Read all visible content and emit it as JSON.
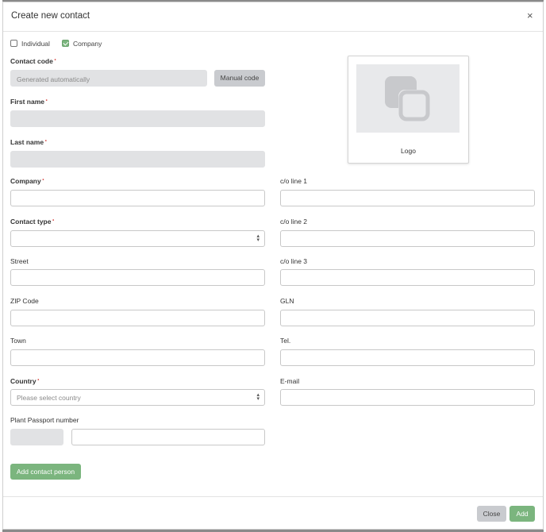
{
  "modal": {
    "title": "Create new contact",
    "close_symbol": "×"
  },
  "type_toggle": {
    "individual": {
      "label": "Individual",
      "checked": false
    },
    "company": {
      "label": "Company",
      "checked": true
    }
  },
  "fields": {
    "contact_code": {
      "label": "Contact code",
      "placeholder": "Generated automatically",
      "button": "Manual code"
    },
    "first_name": {
      "label": "First name"
    },
    "last_name": {
      "label": "Last name"
    },
    "company": {
      "label": "Company"
    },
    "contact_type": {
      "label": "Contact type",
      "value": ""
    },
    "street": {
      "label": "Street"
    },
    "zip_code": {
      "label": "ZIP Code"
    },
    "town": {
      "label": "Town"
    },
    "country": {
      "label": "Country",
      "placeholder": "Please select country"
    },
    "plant_passport": {
      "label": "Plant Passport number"
    },
    "co_line_1": {
      "label": "c/o line 1"
    },
    "co_line_2": {
      "label": "c/o line 2"
    },
    "co_line_3": {
      "label": "c/o line 3"
    },
    "gln": {
      "label": "GLN"
    },
    "tel": {
      "label": "Tel."
    },
    "email": {
      "label": "E-mail"
    }
  },
  "logo": {
    "label": "Logo",
    "icon": "image-placeholder-icon"
  },
  "buttons": {
    "add_contact_person": "Add contact person",
    "close": "Close",
    "add": "Add"
  },
  "colors": {
    "accent_green": "#7bb57e",
    "disabled_grey": "#e1e2e4",
    "required_marker": "#d9534f"
  }
}
